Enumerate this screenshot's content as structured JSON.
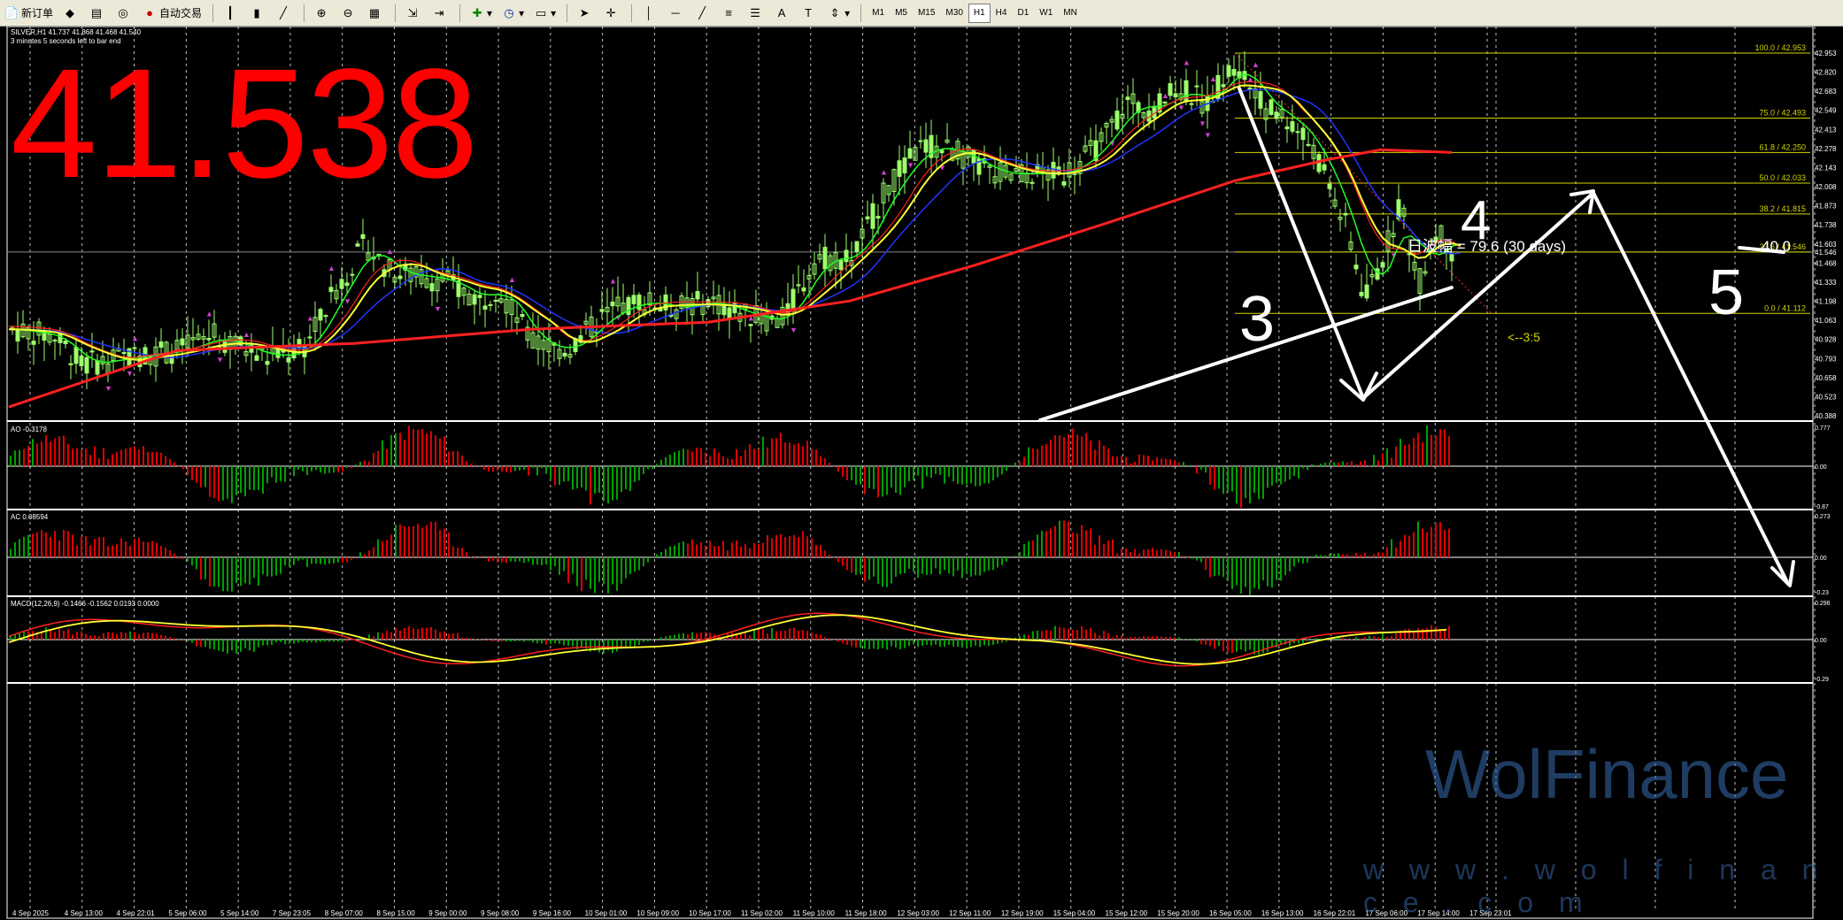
{
  "toolbar": {
    "new_order": "新订单",
    "auto_trade": "自动交易",
    "timeframes": [
      "M1",
      "M5",
      "M15",
      "M30",
      "H1",
      "H4",
      "D1",
      "W1",
      "MN"
    ],
    "active_timeframe": "H1"
  },
  "header": {
    "symbol_line": "SILVER,H1  41.737 41.868 41.468 41.540",
    "bar_timer": "3 minutes 5 seconds left to bar end"
  },
  "big_price": "41.538",
  "price_axis": [
    "42.953",
    "42.820",
    "42.683",
    "42.549",
    "42.413",
    "42.278",
    "42.143",
    "42.008",
    "41.873",
    "41.738",
    "41.603",
    "41.546",
    "41.468",
    "41.333",
    "41.198",
    "41.063",
    "40.928",
    "40.793",
    "40.658",
    "40.523",
    "40.388"
  ],
  "fib_levels": [
    {
      "label": "100.0 / 42.953",
      "price": 42.953
    },
    {
      "label": "75.0 / 42.493",
      "price": 42.493
    },
    {
      "label": "61.8 / 42.250",
      "price": 42.25
    },
    {
      "label": "50.0 / 42.033",
      "price": 42.033
    },
    {
      "label": "38.2 / 41.815",
      "price": 41.815
    },
    {
      "label": "23.6 / 41.546",
      "price": 41.546
    },
    {
      "label": "0.0 / 41.112",
      "price": 41.112
    }
  ],
  "annotations": {
    "daily_range": "日波幅 = 79.6  (30 days)",
    "avg": "40.0",
    "ratio": "<--3:5",
    "wave3": "3",
    "wave4": "4",
    "wave5": "5"
  },
  "indicators": {
    "ao": {
      "label": "AO -0.3178",
      "axis": [
        "0.777",
        "0.00",
        "-0.87"
      ]
    },
    "ac": {
      "label": "AC 0.08594",
      "axis": [
        "0.273",
        "0.00",
        "-0.23"
      ]
    },
    "macd": {
      "label": "MACD(12,26,9) -0.1466 -0.1562 0.0193 0.0000",
      "axis": [
        "0.296",
        "0.00",
        "-0.29"
      ]
    }
  },
  "time_axis": [
    "4 Sep 2025",
    "4 Sep 13:00",
    "4 Sep 22:01",
    "5 Sep 06:00",
    "5 Sep 14:00",
    "7 Sep 23:05",
    "8 Sep 07:00",
    "8 Sep 15:00",
    "9 Sep 00:00",
    "9 Sep 08:00",
    "9 Sep 16:00",
    "10 Sep 01:00",
    "10 Sep 09:00",
    "10 Sep 17:00",
    "11 Sep 02:00",
    "11 Sep 10:00",
    "11 Sep 18:00",
    "12 Sep 03:00",
    "12 Sep 11:00",
    "12 Sep 19:00",
    "15 Sep 04:00",
    "15 Sep 12:00",
    "15 Sep 20:00",
    "16 Sep 05:00",
    "16 Sep 13:00",
    "16 Sep 22:01",
    "17 Sep 06:00",
    "17 Sep 14:00",
    "17 Sep 23:01"
  ],
  "watermark": {
    "logo": "WolFinance",
    "url": "w w w . w o l f i n a n c e . c o m"
  },
  "colors": {
    "bull": "#9cff6b",
    "ma_red": "#ff2020",
    "ma_yellow": "#ffff33",
    "ma_green": "#22ff22",
    "ma_blue": "#2233ff",
    "fib": "#d4d400",
    "histo_up": "#00a000",
    "histo_down": "#e00000",
    "grid": "#ffffff"
  }
}
